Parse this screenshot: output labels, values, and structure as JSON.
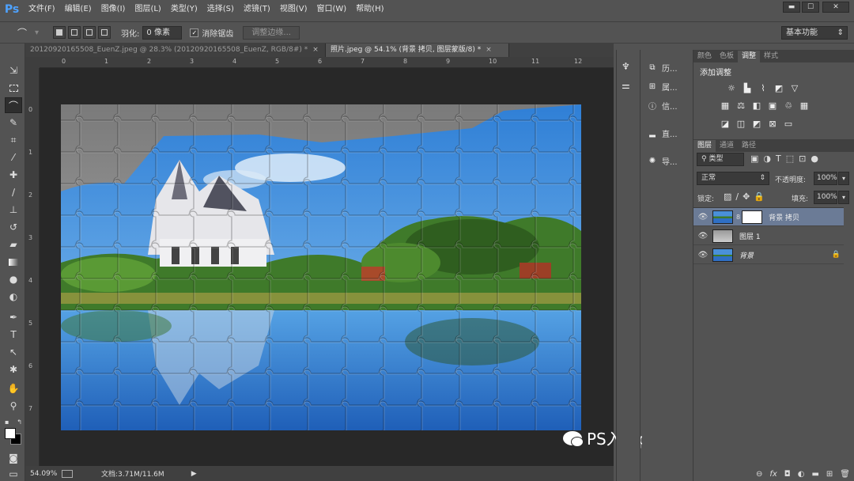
{
  "app": {
    "logo": "Ps"
  },
  "menu": [
    "文件(F)",
    "编辑(E)",
    "图像(I)",
    "图层(L)",
    "类型(Y)",
    "选择(S)",
    "滤镜(T)",
    "视图(V)",
    "窗口(W)",
    "帮助(H)"
  ],
  "window_controls": [
    "▬",
    "☐",
    "✕"
  ],
  "options": {
    "feather_label": "羽化:",
    "feather_value": "0 像素",
    "antialias_label": "消除锯齿",
    "antialias_checked": true,
    "refine_edge_label": "调整边缘...",
    "workspace": "基本功能"
  },
  "tabs": [
    {
      "label": "20120920165508_EuenZ.jpeg @ 28.3% (20120920165508_EuenZ, RGB/8#) *",
      "active": false,
      "close": "×"
    },
    {
      "label": "照片.jpeg @ 54.1% (背景 拷贝, 图层蒙版/8) *",
      "active": true,
      "close": "×"
    }
  ],
  "ruler": {
    "top": [
      "0",
      "1",
      "2",
      "3",
      "4",
      "5",
      "6",
      "7",
      "8",
      "9",
      "10",
      "11",
      "12"
    ],
    "left": [
      "0",
      "1",
      "2",
      "3",
      "4",
      "5",
      "6",
      "7"
    ]
  },
  "status": {
    "zoom": "54.09%",
    "doc_label": "文档:3.71M/11.6M",
    "arrow": "▶"
  },
  "watermark": "PS入门photoshop教程",
  "side_panels": [
    {
      "icon": "history-icon",
      "glyph": "⧉",
      "label": "历..."
    },
    {
      "icon": "properties-icon",
      "glyph": "⊞",
      "label": "属..."
    },
    {
      "icon": "info-icon",
      "glyph": "ⓘ",
      "label": "信..."
    },
    {
      "icon": "histogram-icon",
      "glyph": "▂",
      "label": "直..."
    },
    {
      "icon": "navigator-icon",
      "glyph": "✺",
      "label": "导..."
    }
  ],
  "top_tabs": [
    {
      "label": "颜色",
      "active": false
    },
    {
      "label": "色板",
      "active": false
    },
    {
      "label": "调整",
      "active": true
    },
    {
      "label": "样式",
      "active": false
    }
  ],
  "adjustments": {
    "title": "添加调整"
  },
  "layer_tabs": [
    {
      "label": "图层",
      "active": true
    },
    {
      "label": "通道",
      "active": false
    },
    {
      "label": "路径",
      "active": false
    }
  ],
  "layers_panel": {
    "kind_filter": "类型",
    "blend_mode": "正常",
    "opacity_label": "不透明度:",
    "opacity_value": "100%",
    "lock_label": "锁定:",
    "fill_label": "填充:",
    "fill_value": "100%"
  },
  "layers": [
    {
      "name": "背景 拷贝",
      "selected": true,
      "has_mask": true,
      "locked": false
    },
    {
      "name": "图层 1",
      "selected": false,
      "has_mask": false,
      "locked": false
    },
    {
      "name": "背景",
      "selected": false,
      "has_mask": false,
      "locked": true
    }
  ]
}
